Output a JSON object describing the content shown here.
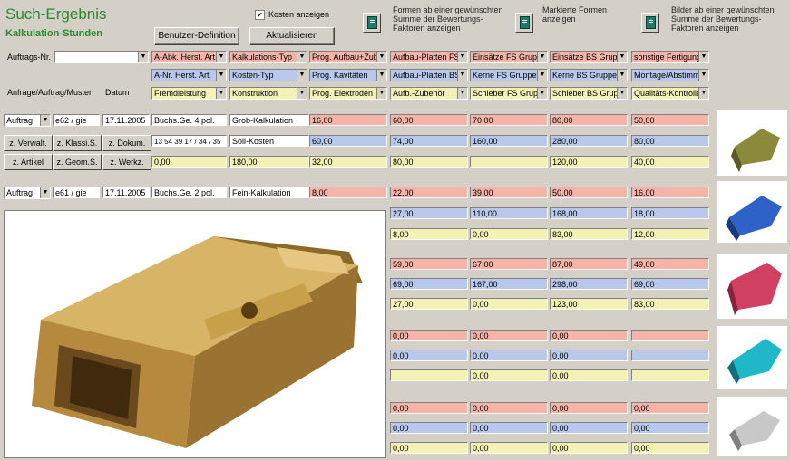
{
  "header": {
    "title": "Such-Ergebnis",
    "subtitle": "Kalkulation-Stunden"
  },
  "toolbar": {
    "kosten_label": "Kosten anzeigen",
    "kosten_checked": "✔",
    "benutzer_label": "Benutzer-Definition",
    "aktualisieren_label": "Aktualisieren",
    "formen_text": "Formen ab einer gewünschten Summe der Bewertungs-Faktoren anzeigen",
    "markierte_text": "Markierte Formen anzeigen",
    "bilder_text": "Bilder ab einer gewünschten Summe der Bewertungs-Faktoren anzeigen"
  },
  "search": {
    "auftrags_label": "Auftrags-Nr.",
    "anfrage_label": "Anfrage/Auftrag/Muster",
    "datum_label": "Datum"
  },
  "columns": {
    "r1": [
      "A-Abk. Herst. Art.",
      "Kalkulations-Typ",
      "Prog. Aufbau+Zub",
      "Aufbau-Platten FS",
      "Einsätze FS Grup",
      "Einsätze BS Grup",
      "sonstige Fertigung"
    ],
    "r2": [
      "A-Nr. Herst. Art.",
      "Kosten-Typ",
      "Prog. Kavitäten",
      "Aufbau-Platten BS",
      "Kerne FS Gruppe",
      "Kerne BS Gruppe",
      "Montage/Abstimm"
    ],
    "r3": [
      "Fremdleistung",
      "Konstruktion",
      "Prog. Elektroden",
      "Aufb.-Zubehör",
      "Schieber FS Grup",
      "Schieber BS Grup",
      "Qualitäts-Kontrolle"
    ]
  },
  "records": [
    {
      "type": "Auftrag",
      "nr": "e62 / gie",
      "date": "17.11.2005",
      "desc": "Buchs.Ge. 4 pol.",
      "kalk": "Grob-Kalkulation",
      "soll": "Soll-Kosten",
      "codes": "13 54 39 17 / 34 / 35",
      "btns": [
        "z. Verwalt.",
        "z. Klassi.S.",
        "z. Dokum.",
        "z. Artikel",
        "z. Geom.S.",
        "z. Werkz."
      ],
      "pink": [
        "16,00",
        "60,00",
        "70,00",
        "80,00",
        "50,00"
      ],
      "blue": [
        "60,00",
        "74,00",
        "160,00",
        "280,00",
        "80,00"
      ],
      "yel_a": "0,00",
      "yel_b": "180,00",
      "yel": [
        "32,00",
        "80,00",
        "",
        "120,00",
        "40,00"
      ]
    },
    {
      "type": "Auftrag",
      "nr": "e61 / gie",
      "date": "17.11.2005",
      "desc": "Buchs.Ge. 2 pol.",
      "kalk": "Fein-Kalkulation",
      "pink": [
        "8,00",
        "22,00",
        "39,00",
        "50,00",
        "16,00"
      ],
      "blue": [
        "27,00",
        "110,00",
        "168,00",
        "18,00"
      ],
      "yel": [
        "8,00",
        "0,00",
        "83,00",
        "12,00"
      ]
    }
  ],
  "extra": [
    {
      "pink": [
        "59,00",
        "67,00",
        "87,00",
        "49,00"
      ],
      "blue": [
        "69,00",
        "167,00",
        "298,00",
        "69,00"
      ],
      "yel": [
        "27,00",
        "0,00",
        "123,00",
        "83,00"
      ]
    },
    {
      "pink": [
        "0,00",
        "0,00",
        "0,00",
        ""
      ],
      "blue": [
        "0,00",
        "0,00",
        "0,00",
        ""
      ],
      "yel": [
        "",
        "0,00",
        "0,00",
        ""
      ]
    },
    {
      "pink": [
        "0,00",
        "0,00",
        "0,00",
        "0,00"
      ],
      "blue": [
        "0,00",
        "0,00",
        "0,00",
        "0,00"
      ],
      "yel": [
        "0,00",
        "0,00",
        "0,00",
        "0,00"
      ]
    }
  ],
  "colors": {
    "pink": "#f6b3a8",
    "blue": "#b7c8ea",
    "yellow": "#f3f1b4",
    "title_green": "#2a8a2a",
    "connector_gold": "#c9a04a"
  }
}
